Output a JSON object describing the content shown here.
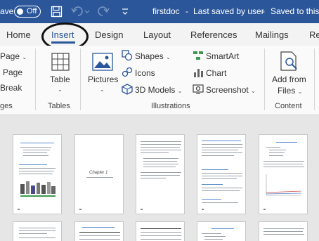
{
  "titlebar": {
    "autosave_partial": "ave",
    "autosave_state": "Off",
    "doc_name": "firstdoc",
    "dash": "-",
    "saved_by": "Last saved by user",
    "saved_to": "Saved to this",
    "bg_color": "#2b579a"
  },
  "tabs": [
    {
      "label": "Home"
    },
    {
      "label": "Insert"
    },
    {
      "label": "Design"
    },
    {
      "label": "Layout"
    },
    {
      "label": "References"
    },
    {
      "label": "Mailings"
    },
    {
      "label": "Re"
    }
  ],
  "ribbon": {
    "pages_group": {
      "pages": "Page",
      "page_break_top": "Page",
      "page_break": "Break",
      "group_label": "ges"
    },
    "tables_group": {
      "table": "Table",
      "group_label": "Tables"
    },
    "illustrations": {
      "pictures": "Pictures",
      "shapes": "Shapes",
      "icons": "Icons",
      "models": "3D Models",
      "smartart": "SmartArt",
      "chart": "Chart",
      "screenshot": "Screenshot",
      "group_label": "Illustrations"
    },
    "content_group": {
      "addin_line1": "Add from",
      "addin_line2": "Files",
      "group_label": "Content"
    }
  },
  "pages": {
    "chapter_title": "Chapter 1"
  }
}
